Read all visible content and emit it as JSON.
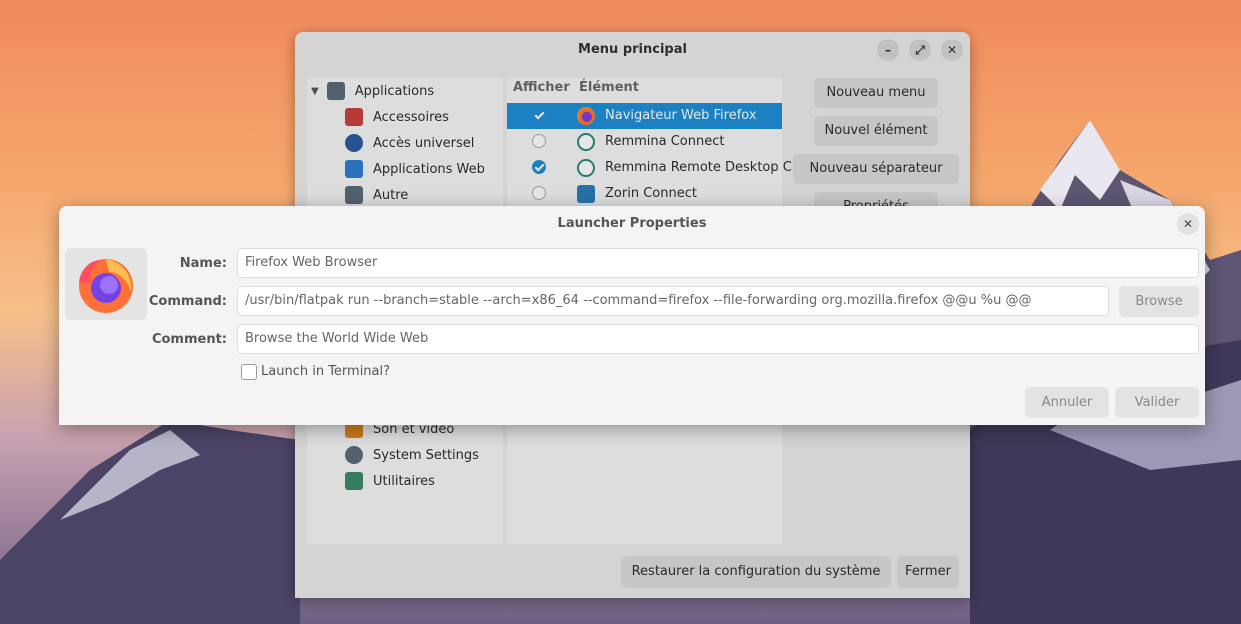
{
  "main_window": {
    "title": "Menu principal",
    "tree": [
      {
        "label": "Applications",
        "icon": "gear-icon",
        "color": "#5c6b7a"
      },
      {
        "label": "Accessoires",
        "icon": "toolbox-icon",
        "color": "#c94040"
      },
      {
        "label": "Accès universel",
        "icon": "accessibility-icon",
        "color": "#2c5aa0"
      },
      {
        "label": "Applications Web",
        "icon": "cloud-icon",
        "color": "#2e7fd1"
      },
      {
        "label": "Autre",
        "icon": "gear-icon",
        "color": "#5c6b7a"
      },
      {
        "label": "Son et vidéo",
        "icon": "music-icon",
        "color": "#e08a1e"
      },
      {
        "label": "System Settings",
        "icon": "gear-icon",
        "color": "#5c6b7a"
      },
      {
        "label": "Utilitaires",
        "icon": "utilities-icon",
        "color": "#3c8a6a"
      }
    ],
    "columns": {
      "show": "Afficher",
      "element": "Élément"
    },
    "items": [
      {
        "label": "Navigateur Web Firefox",
        "checked": true,
        "selected": true
      },
      {
        "label": "Remmina Connect",
        "checked": false,
        "selected": false
      },
      {
        "label": "Remmina Remote Desktop C",
        "checked": true,
        "selected": false
      },
      {
        "label": "Zorin Connect",
        "checked": false,
        "selected": false
      }
    ],
    "buttons": {
      "new_menu": "Nouveau menu",
      "new_item": "Nouvel élément",
      "new_separator": "Nouveau séparateur",
      "properties": "Propriétés",
      "restore": "Restaurer la configuration du système",
      "close": "Fermer"
    }
  },
  "dialog": {
    "title": "Launcher Properties",
    "name_label": "Name:",
    "name_value": "Firefox Web Browser",
    "command_label": "Command:",
    "command_value": "/usr/bin/flatpak run --branch=stable --arch=x86_64 --command=firefox --file-forwarding org.mozilla.firefox @@u %u @@",
    "browse": "Browse",
    "comment_label": "Comment:",
    "comment_value": "Browse the World Wide Web",
    "terminal_label": "Launch in Terminal?",
    "cancel": "Annuler",
    "ok": "Valider"
  },
  "colors": {
    "accent": "#1f8fd8"
  }
}
